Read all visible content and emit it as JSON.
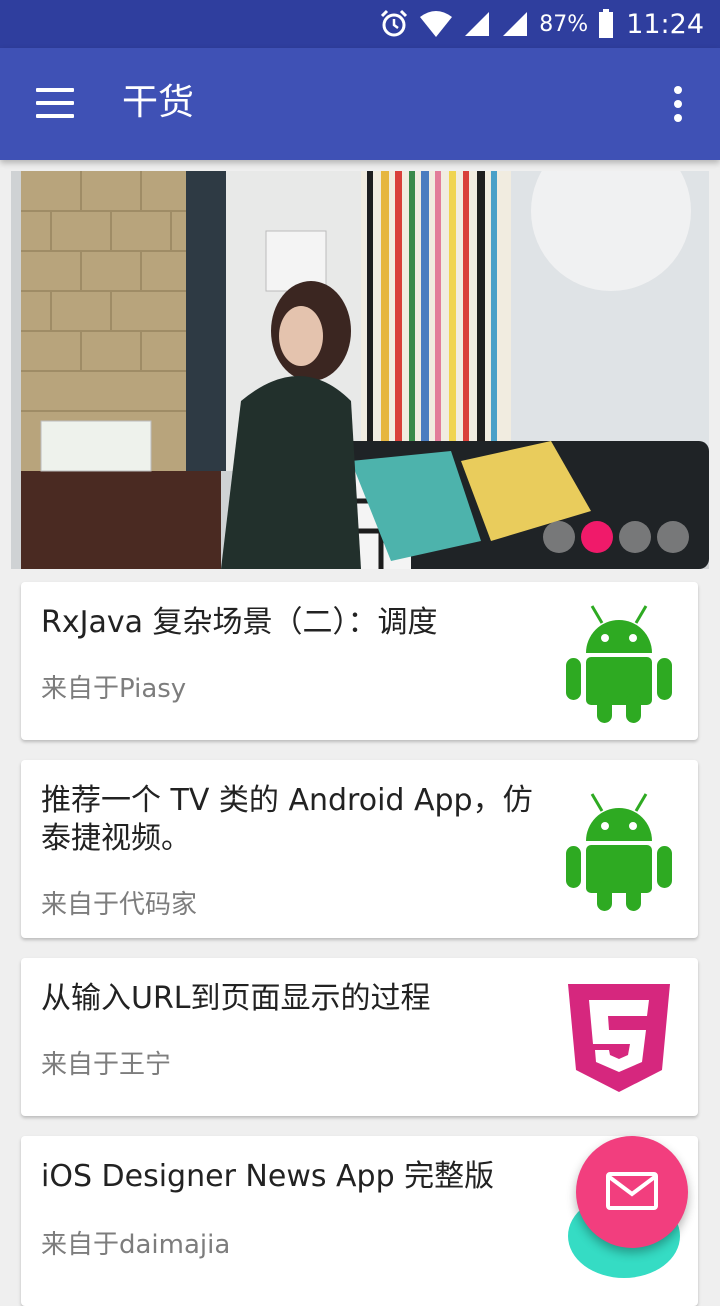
{
  "status_bar": {
    "battery_percent": "87%",
    "time": "11:24",
    "icons": [
      "alarm-icon",
      "wifi-icon",
      "signal-icon",
      "signal-icon",
      "battery-icon"
    ]
  },
  "app_bar": {
    "title": "干货",
    "menu_icon": "hamburger-menu-icon",
    "overflow_icon": "more-vert-icon"
  },
  "banner": {
    "page_count": 4,
    "active_index": 1,
    "active_color": "#f01a6a"
  },
  "articles": [
    {
      "title": "RxJava 复杂场景（二）：调度",
      "source": "来自于Piasy",
      "thumbnail": "android-logo"
    },
    {
      "title": "推荐一个 TV 类的 Android App，仿泰捷视频。",
      "source": "来自于代码家",
      "thumbnail": "android-logo"
    },
    {
      "title": "从输入URL到页面显示的过程",
      "source": "来自于王宁",
      "thumbnail": "html5-logo"
    },
    {
      "title": "iOS Designer News App 完整版",
      "source": "来自于daimajia",
      "thumbnail": "ios-app-logo"
    }
  ],
  "fab": {
    "icon": "email-icon"
  },
  "colors": {
    "primary": "#3f51b5",
    "primary_dark": "#2f3e9e",
    "accent": "#f23e7e",
    "android_green": "#2eaa22",
    "html5_pink": "#d6277e"
  }
}
